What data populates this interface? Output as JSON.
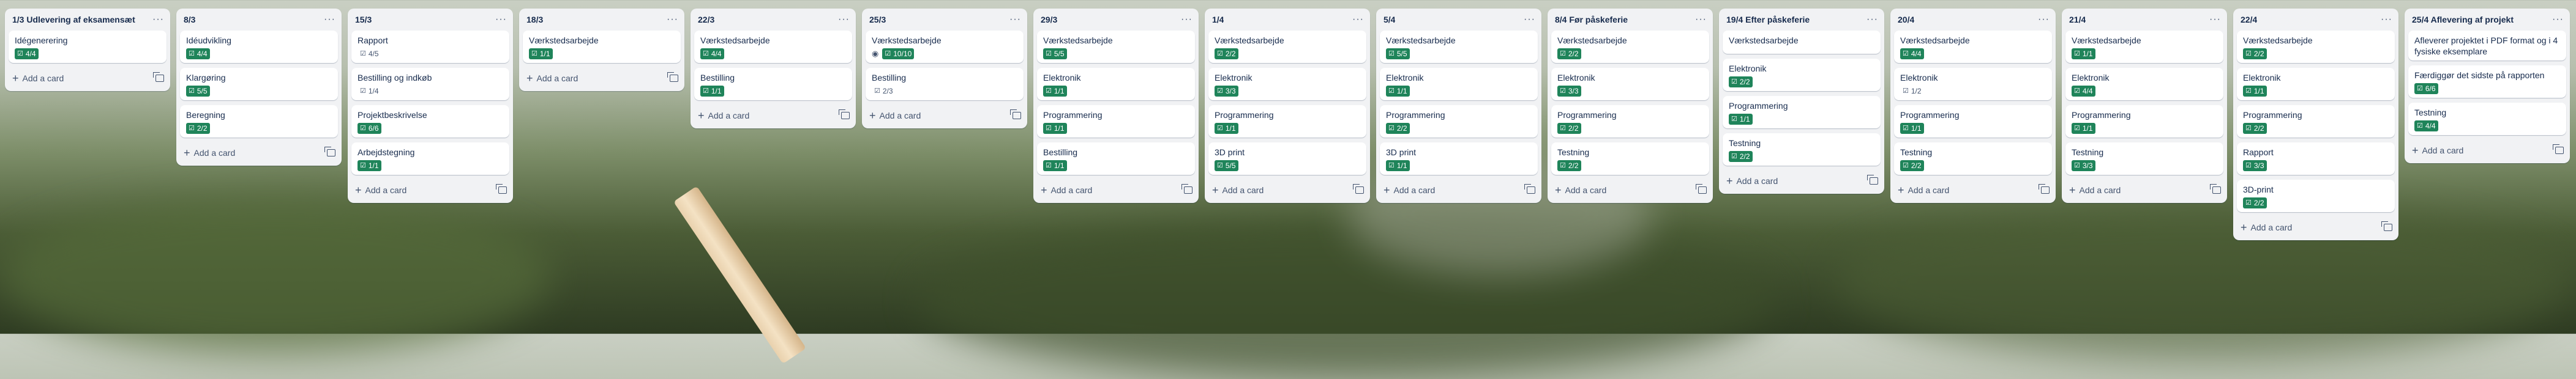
{
  "board": {
    "add_card_label": "Add a card",
    "lists": [
      {
        "title": "1/3 Udlevering af eksamensæt",
        "cards": [
          {
            "title": "Idégenerering",
            "checklist": "4/4",
            "complete": true
          }
        ]
      },
      {
        "title": "8/3",
        "cards": [
          {
            "title": "Idéudvikling",
            "checklist": "4/4",
            "complete": true
          },
          {
            "title": "Klargøring",
            "checklist": "5/5",
            "complete": true
          },
          {
            "title": "Beregning",
            "checklist": "2/2",
            "complete": true
          }
        ]
      },
      {
        "title": "15/3",
        "cards": [
          {
            "title": "Rapport",
            "checklist": "4/5",
            "complete": false
          },
          {
            "title": "Bestilling og indkøb",
            "checklist": "1/4",
            "complete": false
          },
          {
            "title": "Projektbeskrivelse",
            "checklist": "6/6",
            "complete": true
          },
          {
            "title": "Arbejdstegning",
            "checklist": "1/1",
            "complete": true
          }
        ]
      },
      {
        "title": "18/3",
        "cards": [
          {
            "title": "Værkstedsarbejde",
            "checklist": "1/1",
            "complete": true
          }
        ]
      },
      {
        "title": "22/3",
        "cards": [
          {
            "title": "Værkstedsarbejde",
            "checklist": "4/4",
            "complete": true
          },
          {
            "title": "Bestilling",
            "checklist": "1/1",
            "complete": true
          }
        ]
      },
      {
        "title": "25/3",
        "cards": [
          {
            "title": "Værkstedsarbejde",
            "checklist": "10/10",
            "complete": true,
            "watch": true
          },
          {
            "title": "Bestilling",
            "checklist": "2/3",
            "complete": false
          }
        ]
      },
      {
        "title": "29/3",
        "cards": [
          {
            "title": "Værkstedsarbejde",
            "checklist": "5/5",
            "complete": true
          },
          {
            "title": "Elektronik",
            "checklist": "1/1",
            "complete": true
          },
          {
            "title": "Programmering",
            "checklist": "1/1",
            "complete": true
          },
          {
            "title": "Bestilling",
            "checklist": "1/1",
            "complete": true
          }
        ]
      },
      {
        "title": "1/4",
        "cards": [
          {
            "title": "Værkstedsarbejde",
            "checklist": "2/2",
            "complete": true
          },
          {
            "title": "Elektronik",
            "checklist": "3/3",
            "complete": true
          },
          {
            "title": "Programmering",
            "checklist": "1/1",
            "complete": true
          },
          {
            "title": "3D print",
            "checklist": "5/5",
            "complete": true
          }
        ]
      },
      {
        "title": "5/4",
        "cards": [
          {
            "title": "Værkstedsarbejde",
            "checklist": "5/5",
            "complete": true
          },
          {
            "title": "Elektronik",
            "checklist": "1/1",
            "complete": true
          },
          {
            "title": "Programmering",
            "checklist": "2/2",
            "complete": true
          },
          {
            "title": "3D print",
            "checklist": "1/1",
            "complete": true
          }
        ]
      },
      {
        "title": "8/4 Før påskeferie",
        "cards": [
          {
            "title": "Værkstedsarbejde",
            "checklist": "2/2",
            "complete": true
          },
          {
            "title": "Elektronik",
            "checklist": "3/3",
            "complete": true
          },
          {
            "title": "Programmering",
            "checklist": "2/2",
            "complete": true
          },
          {
            "title": "Testning",
            "checklist": "2/2",
            "complete": true
          }
        ]
      },
      {
        "title": "19/4 Efter påskeferie",
        "cards": [
          {
            "title": "Værkstedsarbejde",
            "checklist": "",
            "complete": false,
            "no_badge": true
          },
          {
            "title": "Elektronik",
            "checklist": "2/2",
            "complete": true
          },
          {
            "title": "Programmering",
            "checklist": "1/1",
            "complete": true
          },
          {
            "title": "Testning",
            "checklist": "2/2",
            "complete": true
          }
        ]
      },
      {
        "title": "20/4",
        "cards": [
          {
            "title": "Værkstedsarbejde",
            "checklist": "4/4",
            "complete": true
          },
          {
            "title": "Elektronik",
            "checklist": "1/2",
            "complete": false
          },
          {
            "title": "Programmering",
            "checklist": "1/1",
            "complete": true
          },
          {
            "title": "Testning",
            "checklist": "2/2",
            "complete": true
          }
        ]
      },
      {
        "title": "21/4",
        "cards": [
          {
            "title": "Værkstedsarbejde",
            "checklist": "1/1",
            "complete": true
          },
          {
            "title": "Elektronik",
            "checklist": "4/4",
            "complete": true
          },
          {
            "title": "Programmering",
            "checklist": "1/1",
            "complete": true
          },
          {
            "title": "Testning",
            "checklist": "3/3",
            "complete": true
          }
        ]
      },
      {
        "title": "22/4",
        "cards": [
          {
            "title": "Værkstedsarbejde",
            "checklist": "2/2",
            "complete": true
          },
          {
            "title": "Elektronik",
            "checklist": "1/1",
            "complete": true
          },
          {
            "title": "Programmering",
            "checklist": "2/2",
            "complete": true
          },
          {
            "title": "Rapport",
            "checklist": "3/3",
            "complete": true
          },
          {
            "title": "3D-print",
            "checklist": "2/2",
            "complete": true
          }
        ]
      },
      {
        "title": "25/4 Aflevering af projekt",
        "cards": [
          {
            "title": "Afleverer projektet i PDF format og i 4 fysiske eksemplare",
            "checklist": "",
            "complete": false,
            "no_badge": true
          },
          {
            "title": "Færdiggør det sidste på rapporten",
            "checklist": "6/6",
            "complete": true
          },
          {
            "title": "Testning",
            "checklist": "4/4",
            "complete": true
          }
        ]
      }
    ]
  }
}
